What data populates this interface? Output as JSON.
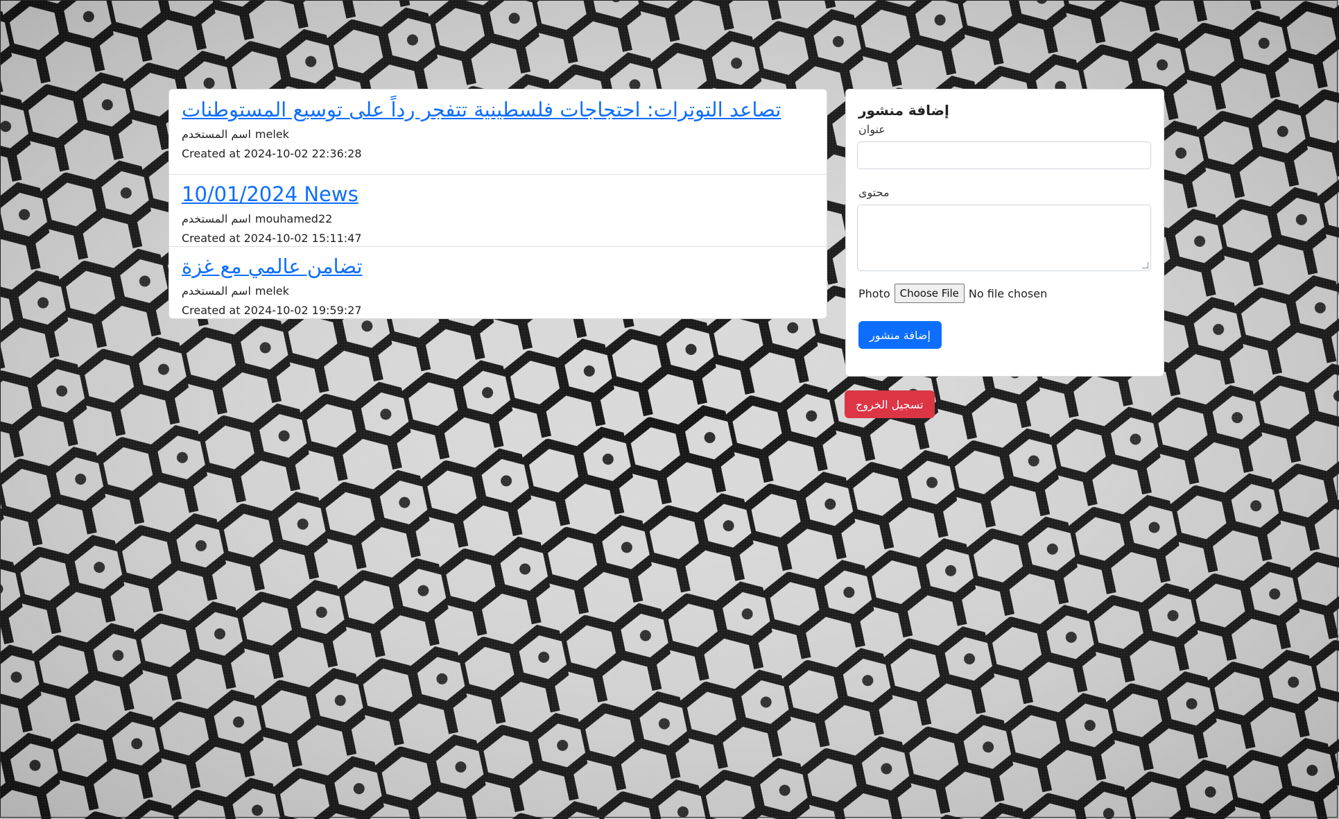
{
  "posts": [
    {
      "title": "تصاعد التوترات: احتجاجات فلسطينية تتفجر رداً على توسيع المستوطنات",
      "username_label": "اسم المستخدم",
      "username": "melek",
      "created_label": "Created at",
      "created_at": "2024-10-02 22:36:28"
    },
    {
      "title": "10/01/2024 News",
      "username_label": "اسم المستخدم",
      "username": "mouhamed22",
      "created_label": "Created at",
      "created_at": "2024-10-02 15:11:47"
    },
    {
      "title": "تضامن عالمي مع غزة",
      "username_label": "اسم المستخدم",
      "username": "melek",
      "created_label": "Created at",
      "created_at": "2024-10-02 19:59:27"
    }
  ],
  "form": {
    "title": "إضافة منشور",
    "title_field_label": "عنوان",
    "title_field_value": "",
    "content_field_label": "محتوى",
    "content_field_value": "",
    "photo_label": "Photo",
    "choose_file_label": "Choose File",
    "no_file_label": "No file chosen",
    "submit_label": "إضافة منشور"
  },
  "logout_label": "تسجيل الخروج",
  "colors": {
    "link": "#0d6efd",
    "primary": "#0d6efd",
    "danger": "#dc3545"
  },
  "background": {
    "pattern": "keffiyeh-fabric"
  }
}
